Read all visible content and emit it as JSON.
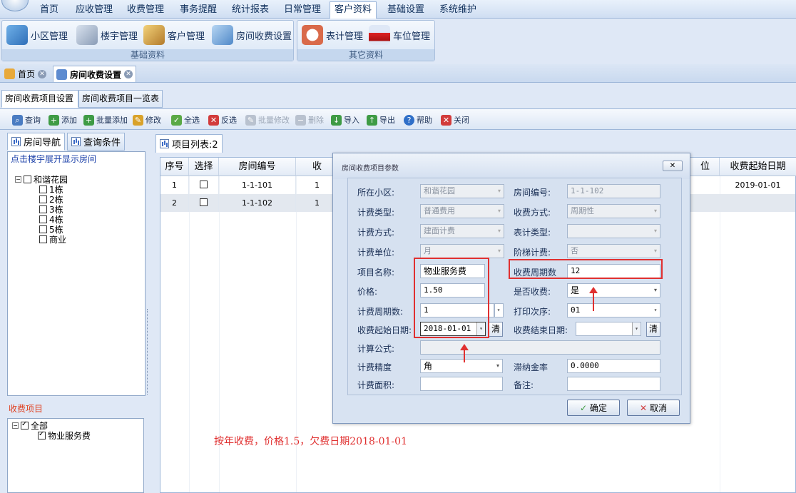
{
  "menu": [
    "首页",
    "应收管理",
    "收费管理",
    "事务提醒",
    "统计报表",
    "日常管理",
    "客户资料",
    "基础设置",
    "系统维护"
  ],
  "ribbon": {
    "group1": {
      "caption": "基础资料",
      "buttons": [
        "小区管理",
        "楼宇管理",
        "客户管理",
        "房间收费设置"
      ]
    },
    "group2": {
      "caption": "其它资料",
      "buttons": [
        "表计管理",
        "车位管理"
      ]
    }
  },
  "doc_tabs": [
    "首页",
    "房间收费设置"
  ],
  "sub_tabs": [
    "房间收费项目设置",
    "房间收费项目一览表"
  ],
  "toolbar": [
    "查询",
    "添加",
    "批量添加",
    "修改",
    "全选",
    "反选",
    "批量修改",
    "删除",
    "导入",
    "导出",
    "帮助",
    "关闭"
  ],
  "left": {
    "tabs": [
      "房间导航",
      "查询条件"
    ],
    "hint": "点击楼宇展开显示房间",
    "tree_root": "和谐花园",
    "tree_children": [
      "1栋",
      "2栋",
      "3栋",
      "4栋",
      "5栋",
      "商业"
    ],
    "fee_title": "收费项目",
    "fee_root": "全部",
    "fee_child": "物业服务费"
  },
  "grid": {
    "tab": "项目列表:2",
    "headers": [
      "序号",
      "选择",
      "房间编号",
      "收",
      "位",
      "收费起始日期"
    ],
    "rows": [
      {
        "no": "1",
        "room": "1-1-101",
        "first": "1",
        "start": "2019-01-01"
      },
      {
        "no": "2",
        "room": "1-1-102",
        "first": "1",
        "start": ""
      }
    ]
  },
  "dialog": {
    "title": "房间收费项目参数",
    "close": "✕",
    "labels": {
      "community": "所在小区:",
      "room_no": "房间编号:",
      "fee_type": "计费类型:",
      "collect_mode": "收费方式:",
      "calc_mode": "计费方式:",
      "meter_type": "表计类型:",
      "unit": "计费单位:",
      "tiered": "阶梯计费:",
      "item_name": "项目名称:",
      "cycles": "收费周期数",
      "price": "价格:",
      "is_collect": "是否收费:",
      "calc_cycles": "计费周期数:",
      "print_order": "打印次序:",
      "start_date": "收费起始日期:",
      "end_date": "收费结束日期:",
      "formula": "计算公式:",
      "precision": "计费精度",
      "late_rate": "滞纳金率",
      "area": "计费面积:",
      "remark": "备注:"
    },
    "values": {
      "community": "和谐花园",
      "room_no": "1-1-102",
      "fee_type": "普通费用",
      "collect_mode": "周期性",
      "calc_mode": "建面计费",
      "meter_type": "",
      "unit": "月",
      "tiered": "否",
      "item_name": "物业服务费",
      "cycles": "12",
      "price": "1.50",
      "is_collect": "是",
      "calc_cycles": "1",
      "print_order": "01",
      "start_date": "2018-01-01",
      "end_date": "",
      "formula": "",
      "precision": "角",
      "late_rate": "0.0000",
      "area": "",
      "remark": ""
    },
    "clear_label": "清",
    "ok": "确定",
    "cancel": "取消"
  },
  "annotation": "按年收费，价格1.5，欠费日期2018-01-01"
}
